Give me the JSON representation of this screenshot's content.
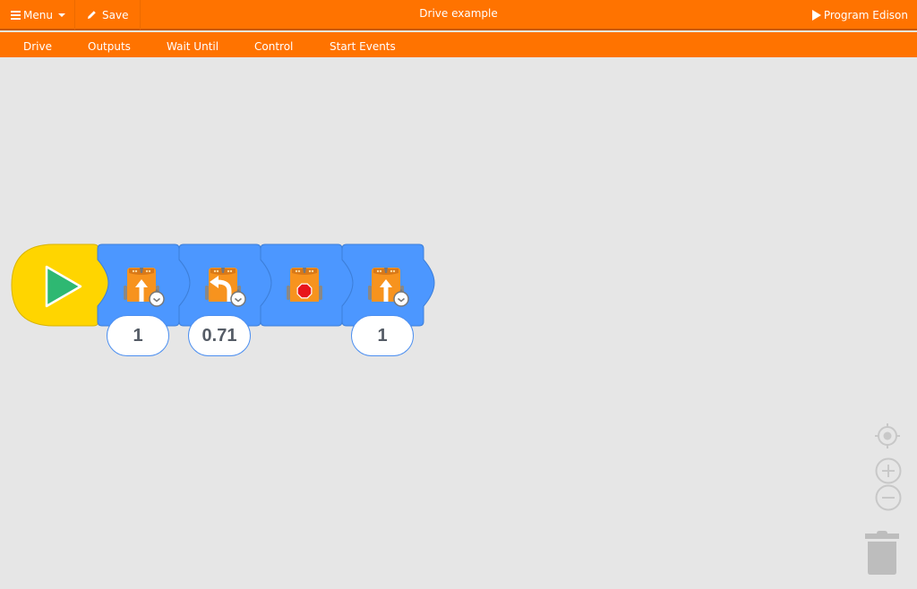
{
  "header": {
    "menu_label": "Menu",
    "save_label": "Save",
    "title": "Drive example",
    "program_label": "Program Edison"
  },
  "tabs": [
    {
      "label": "Drive"
    },
    {
      "label": "Outputs"
    },
    {
      "label": "Wait Until"
    },
    {
      "label": "Control"
    },
    {
      "label": "Start Events"
    }
  ],
  "program": {
    "start_block": {
      "icon": "play-icon"
    },
    "blocks": [
      {
        "name": "drive-forward-time-block",
        "icon": "robot-forward-timer-icon",
        "value": "1"
      },
      {
        "name": "turn-left-time-block",
        "icon": "robot-turn-left-timer-icon",
        "value": "0.71"
      },
      {
        "name": "stop-block",
        "icon": "robot-stop-icon",
        "value": null
      },
      {
        "name": "drive-forward-time-block",
        "icon": "robot-forward-timer-icon",
        "value": "1"
      }
    ]
  },
  "colors": {
    "accent": "#ff7300",
    "block_blue": "#4c97ff",
    "start_yellow": "#ffd500",
    "play_green": "#2eb872",
    "stop_red": "#e8151b",
    "robot_orange": "#f7931e",
    "canvas": "#e6e6e6"
  },
  "controls": {
    "recenter": "recenter-icon",
    "zoom_in": "zoom-in-icon",
    "zoom_out": "zoom-out-icon",
    "trash": "trash-icon"
  }
}
